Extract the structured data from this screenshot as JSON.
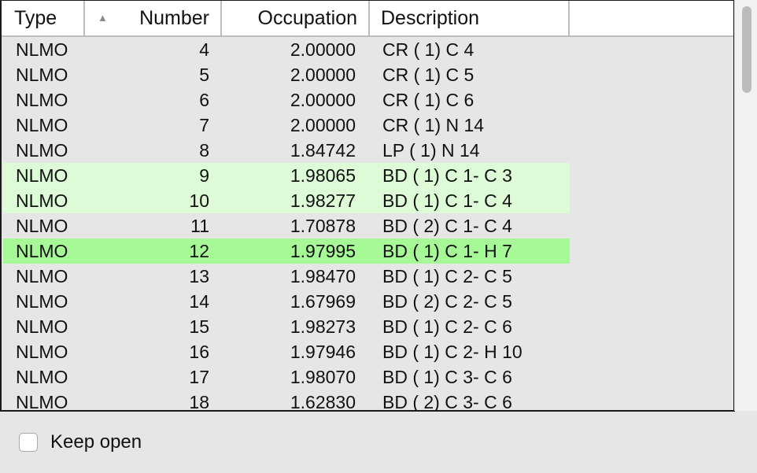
{
  "table": {
    "columns": {
      "type": "Type",
      "number": "Number",
      "occupation": "Occupation",
      "description": "Description"
    },
    "sort_indicator": "▲",
    "rows": [
      {
        "type": "NLMO",
        "number": "4",
        "occupation": "2.00000",
        "description": "CR ( 1) C 4",
        "highlight": "none"
      },
      {
        "type": "NLMO",
        "number": "5",
        "occupation": "2.00000",
        "description": "CR ( 1) C 5",
        "highlight": "none"
      },
      {
        "type": "NLMO",
        "number": "6",
        "occupation": "2.00000",
        "description": "CR ( 1) C 6",
        "highlight": "none"
      },
      {
        "type": "NLMO",
        "number": "7",
        "occupation": "2.00000",
        "description": "CR ( 1) N 14",
        "highlight": "none"
      },
      {
        "type": "NLMO",
        "number": "8",
        "occupation": "1.84742",
        "description": "LP ( 1) N 14",
        "highlight": "none"
      },
      {
        "type": "NLMO",
        "number": "9",
        "occupation": "1.98065",
        "description": "BD ( 1) C 1- C 3",
        "highlight": "light"
      },
      {
        "type": "NLMO",
        "number": "10",
        "occupation": "1.98277",
        "description": "BD ( 1) C 1- C 4",
        "highlight": "light"
      },
      {
        "type": "NLMO",
        "number": "11",
        "occupation": "1.70878",
        "description": "BD ( 2) C 1- C 4",
        "highlight": "none"
      },
      {
        "type": "NLMO",
        "number": "12",
        "occupation": "1.97995",
        "description": "BD ( 1) C 1- H 7",
        "highlight": "strong"
      },
      {
        "type": "NLMO",
        "number": "13",
        "occupation": "1.98470",
        "description": "BD ( 1) C 2- C 5",
        "highlight": "none"
      },
      {
        "type": "NLMO",
        "number": "14",
        "occupation": "1.67969",
        "description": "BD ( 2) C 2- C 5",
        "highlight": "none"
      },
      {
        "type": "NLMO",
        "number": "15",
        "occupation": "1.98273",
        "description": "BD ( 1) C 2- C 6",
        "highlight": "none"
      },
      {
        "type": "NLMO",
        "number": "16",
        "occupation": "1.97946",
        "description": "BD ( 1) C 2- H 10",
        "highlight": "none"
      },
      {
        "type": "NLMO",
        "number": "17",
        "occupation": "1.98070",
        "description": "BD ( 1) C 3- C 6",
        "highlight": "none"
      },
      {
        "type": "NLMO",
        "number": "18",
        "occupation": "1.62830",
        "description": "BD ( 2) C 3- C 6",
        "highlight": "none"
      }
    ]
  },
  "footer": {
    "keep_open_label": "Keep open",
    "keep_open_checked": false
  },
  "colors": {
    "highlight_light": "#dcfbd6",
    "highlight_strong": "#a6f996",
    "background": "#e6e6e6"
  }
}
